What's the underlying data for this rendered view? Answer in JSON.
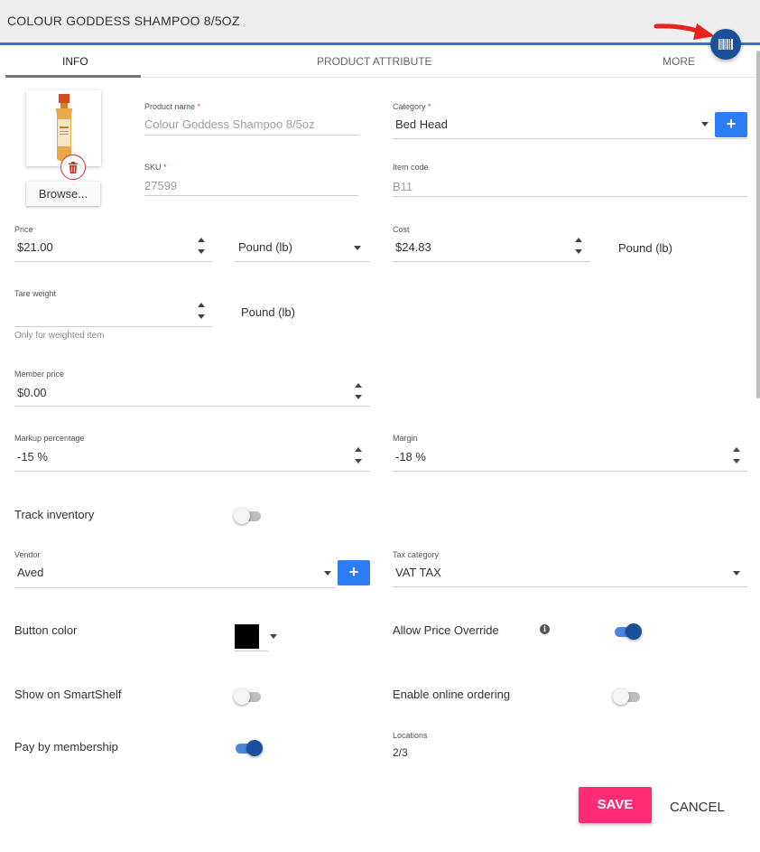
{
  "header": {
    "title": "COLOUR GODDESS SHAMPOO 8/5OZ",
    "barcode_icon": "barcode-icon",
    "annotation_arrow_color": "#e8231c"
  },
  "tabs": [
    {
      "label": "INFO",
      "active": true
    },
    {
      "label": "PRODUCT ATTRIBUTE",
      "active": false
    },
    {
      "label": "MORE",
      "active": false
    }
  ],
  "image": {
    "delete_icon": "trash-icon",
    "browse_label": "Browse..."
  },
  "fields": {
    "product_name": {
      "label": "Product name",
      "required": "*",
      "value": "Colour Goddess Shampoo 8/5oz"
    },
    "category": {
      "label": "Category",
      "required": "*",
      "value": "Bed Head"
    },
    "sku": {
      "label": "SKU",
      "required": "*",
      "value": "27599"
    },
    "item_code": {
      "label": "Item code",
      "value": "B11"
    },
    "price": {
      "label": "Price",
      "value": "$21.00",
      "unit": "Pound (lb)"
    },
    "cost": {
      "label": "Cost",
      "value": "$24.83",
      "unit": "Pound (lb)"
    },
    "tare_weight": {
      "label": "Tare weight",
      "value": "",
      "unit": "Pound (lb)",
      "hint": "Only for weighted item"
    },
    "member_price": {
      "label": "Member price",
      "value": "$0.00"
    },
    "markup": {
      "label": "Markup percentage",
      "value": "-15 %"
    },
    "margin": {
      "label": "Margin",
      "value": "-18 %"
    },
    "vendor": {
      "label": "Vendor",
      "value": "Aved"
    },
    "tax_category": {
      "label": "Tax category",
      "value": "VAT TAX"
    },
    "locations": {
      "label": "Locations",
      "value": "2/3"
    }
  },
  "toggles": {
    "track_inventory": {
      "label": "Track inventory",
      "on": false
    },
    "allow_price_override": {
      "label": "Allow Price Override",
      "on": true
    },
    "show_on_smartshelf": {
      "label": "Show on SmartShelf",
      "on": false
    },
    "enable_online_ordering": {
      "label": "Enable online ordering",
      "on": false
    },
    "pay_by_membership": {
      "label": "Pay by membership",
      "on": true
    }
  },
  "button_color": {
    "label": "Button color",
    "value": "#000000"
  },
  "actions": {
    "save": "SAVE",
    "cancel": "CANCEL"
  },
  "colors": {
    "accent": "#1a4f9c",
    "add_button": "#2d7bf5",
    "save_button": "#ff2b74",
    "tab_border": "#3b6fd6"
  }
}
